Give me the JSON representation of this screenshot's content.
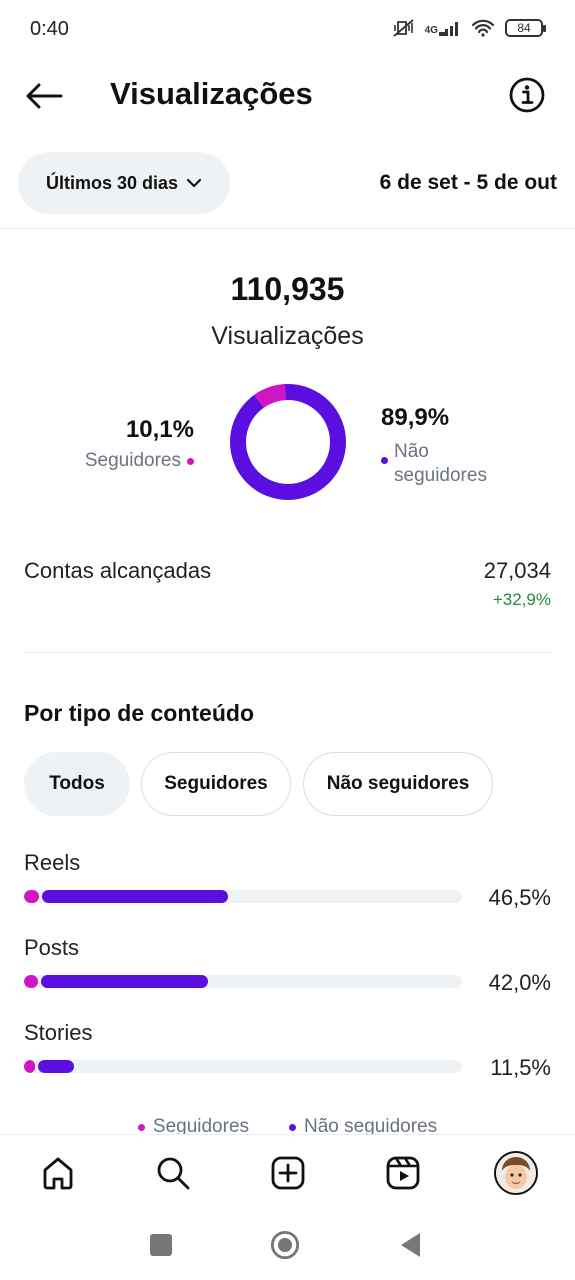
{
  "status_bar": {
    "time": "0:40",
    "network": "4G",
    "battery": "84"
  },
  "header": {
    "title": "Visualizações"
  },
  "filter": {
    "period_label": "Últimos 30 dias",
    "date_range": "6 de set - 5 de out"
  },
  "totals": {
    "views_value": "110,935",
    "views_label": "Visualizações",
    "followers_percent": "10,1%",
    "followers_label": "Seguidores",
    "non_followers_percent": "89,9%",
    "non_followers_label_line1": "Não",
    "non_followers_label_line2": "seguidores",
    "followers_share": 0.101
  },
  "reach": {
    "label": "Contas alcançadas",
    "value": "27,034",
    "change": "+32,9%"
  },
  "content_type": {
    "title": "Por tipo de conteúdo",
    "chips": [
      {
        "label": "Todos",
        "active": true
      },
      {
        "label": "Seguidores",
        "active": false
      },
      {
        "label": "Não seguidores",
        "active": false
      }
    ],
    "rows": [
      {
        "label": "Reels",
        "percent": "46,5%",
        "value": 0.465,
        "followers_part": 0.035
      },
      {
        "label": "Posts",
        "percent": "42,0%",
        "value": 0.42,
        "followers_part": 0.032
      },
      {
        "label": "Stories",
        "percent": "11,5%",
        "value": 0.115,
        "followers_part": 0.025
      }
    ],
    "legend": {
      "followers": "Seguidores",
      "non_followers": "Não seguidores"
    }
  },
  "colors": {
    "followers": "#d015c4",
    "non_followers": "#5a0fe0",
    "positive": "#228b3c"
  },
  "icons": {
    "back": "arrow-left-icon",
    "info": "info-icon",
    "chevron": "chevron-down-icon",
    "nav": [
      "home-icon",
      "search-icon",
      "create-icon",
      "reels-icon",
      "profile-avatar"
    ],
    "system": [
      "recents-icon",
      "home-circle-icon",
      "back-triangle-icon"
    ]
  }
}
